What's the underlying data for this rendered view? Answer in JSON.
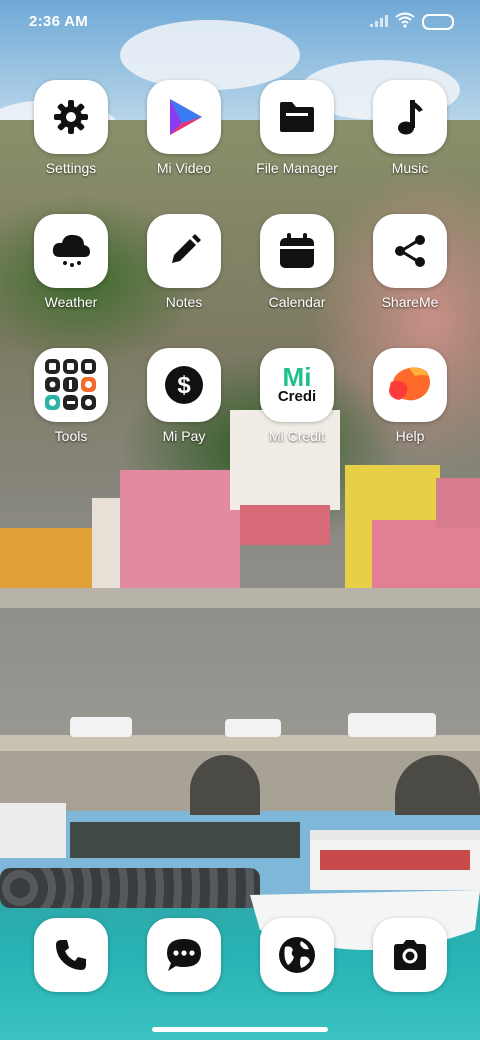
{
  "status_bar": {
    "time": "2:36 AM"
  },
  "apps": [
    {
      "label": "Settings",
      "icon": "gear-icon"
    },
    {
      "label": "Mi Video",
      "icon": "play-triangle-icon"
    },
    {
      "label": "File Manager",
      "icon": "folder-icon"
    },
    {
      "label": "Music",
      "icon": "music-note-icon"
    },
    {
      "label": "Weather",
      "icon": "cloud-rain-icon"
    },
    {
      "label": "Notes",
      "icon": "pencil-icon"
    },
    {
      "label": "Calendar",
      "icon": "calendar-icon"
    },
    {
      "label": "ShareMe",
      "icon": "share-icon"
    },
    {
      "label": "Tools",
      "icon": "tools-folder-icon"
    },
    {
      "label": "Mi Pay",
      "icon": "dollar-coin-icon"
    },
    {
      "label": "Mi Credit",
      "icon": "mi-credit-logo",
      "logo_text": "Mi",
      "logo_subtext": "Credi"
    },
    {
      "label": "Help",
      "icon": "help-blob-icon"
    }
  ],
  "dock": [
    {
      "icon": "phone-icon"
    },
    {
      "icon": "messages-icon"
    },
    {
      "icon": "browser-globe-icon"
    },
    {
      "icon": "camera-icon"
    }
  ],
  "colors": {
    "label_text": "#ffffff",
    "tile_bg": "#ffffff",
    "glyph": "#111111"
  }
}
